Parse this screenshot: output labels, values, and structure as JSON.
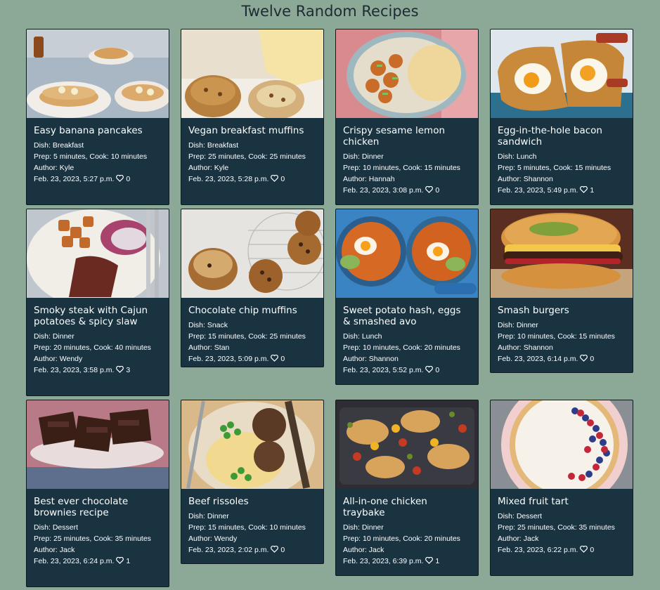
{
  "page": {
    "title": "Twelve Random Recipes"
  },
  "recipes": [
    {
      "title": "Easy banana pancakes",
      "dish": "Dish: Breakfast",
      "time": "Prep: 5 minutes, Cook: 10 minutes",
      "author": "Author: Kyle",
      "date": "Feb. 23, 2023, 5:27 p.m.",
      "likes": "0",
      "image": "pancakes-image"
    },
    {
      "title": "Vegan breakfast muffins",
      "dish": "Dish: Breakfast",
      "time": "Prep: 25 minutes, Cook: 25 minutes",
      "author": "Author: Kyle",
      "date": "Feb. 23, 2023, 5:28 p.m.",
      "likes": "0",
      "image": "muffins-image"
    },
    {
      "title": "Crispy sesame lemon chicken",
      "dish": "Dish: Dinner",
      "time": "Prep: 10 minutes, Cook: 15 minutes",
      "author": "Author: Hannah",
      "date": "Feb. 23, 2023, 3:08 p.m.",
      "likes": "0",
      "image": "sesame-chicken-image"
    },
    {
      "title": "Egg-in-the-hole bacon sandwich",
      "dish": "Dish: Lunch",
      "time": "Prep: 5 minutes, Cook: 15 minutes",
      "author": "Author: Shannon",
      "date": "Feb. 23, 2023, 5:49 p.m.",
      "likes": "1",
      "image": "egg-sandwich-image"
    },
    {
      "title": "Smoky steak with Cajun potatoes & spicy slaw",
      "dish": "Dish: Dinner",
      "time": "Prep: 20 minutes, Cook: 40 minutes",
      "author": "Author: Wendy",
      "date": "Feb. 23, 2023, 3:58 p.m.",
      "likes": "3",
      "image": "steak-image"
    },
    {
      "title": "Chocolate chip muffins",
      "dish": "Dish: Snack",
      "time": "Prep: 15 minutes, Cook: 25 minutes",
      "author": "Author: Stan",
      "date": "Feb. 23, 2023, 5:09 p.m.",
      "likes": "0",
      "image": "choc-muffins-image"
    },
    {
      "title": "Sweet potato hash, eggs & smashed avo",
      "dish": "Dish: Lunch",
      "time": "Prep: 10 minutes, Cook: 20 minutes",
      "author": "Author: Shannon",
      "date": "Feb. 23, 2023, 5:52 p.m.",
      "likes": "0",
      "image": "sweet-potato-hash-image"
    },
    {
      "title": "Smash burgers",
      "dish": "Dish: Dinner",
      "time": "Prep: 10 minutes, Cook: 15 minutes",
      "author": "Author: Shannon",
      "date": "Feb. 23, 2023, 6:14 p.m.",
      "likes": "0",
      "image": "burger-image"
    },
    {
      "title": "Best ever chocolate brownies recipe",
      "dish": "Dish: Dessert",
      "time": "Prep: 25 minutes, Cook: 35 minutes",
      "author": "Author: Jack",
      "date": "Feb. 23, 2023, 6:24 p.m.",
      "likes": "1",
      "image": "brownies-image"
    },
    {
      "title": "Beef rissoles",
      "dish": "Dish: Dinner",
      "time": "Prep: 15 minutes, Cook: 10 minutes",
      "author": "Author: Wendy",
      "date": "Feb. 23, 2023, 2:02 p.m.",
      "likes": "0",
      "image": "rissoles-image"
    },
    {
      "title": "All-in-one chicken traybake",
      "dish": "Dish: Dinner",
      "time": "Prep: 10 minutes, Cook: 20 minutes",
      "author": "Author: Jack",
      "date": "Feb. 23, 2023, 6:39 p.m.",
      "likes": "1",
      "image": "traybake-image"
    },
    {
      "title": "Mixed fruit tart",
      "dish": "Dish: Dessert",
      "time": "Prep: 25 minutes, Cook: 35 minutes",
      "author": "Author: Jack",
      "date": "Feb. 23, 2023, 6:22 p.m.",
      "likes": "0",
      "image": "fruit-tart-image"
    }
  ],
  "colors": {
    "background": "#8ca897",
    "card": "#193341",
    "text": "#ffffff"
  }
}
